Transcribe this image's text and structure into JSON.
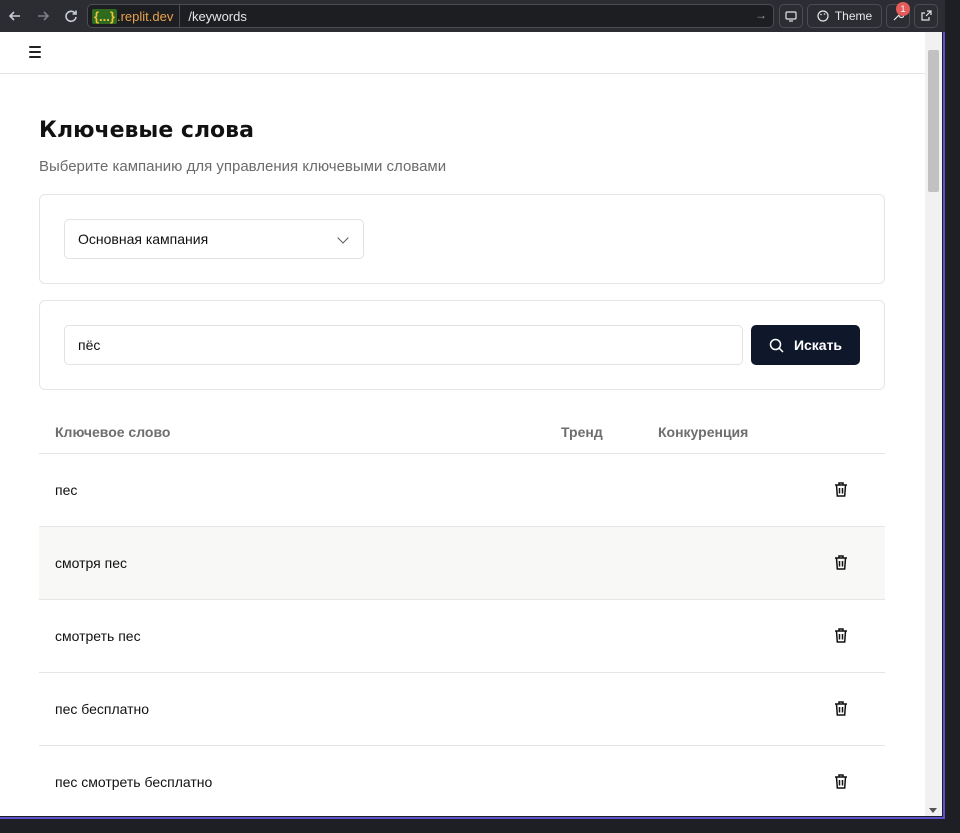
{
  "browser": {
    "url_host": ".replit.dev",
    "url_braces": "{...}",
    "url_path": "/keywords",
    "theme_label": "Theme",
    "notification_count": "1"
  },
  "page": {
    "title": "Ключевые слова",
    "subtitle": "Выберите кампанию для управления ключевыми словами"
  },
  "campaign_select": {
    "value": "Основная кампания"
  },
  "search": {
    "value": "пёс",
    "button_label": "Искать"
  },
  "table": {
    "columns": [
      "Ключевое слово",
      "Тренд",
      "Конкуренция"
    ],
    "rows": [
      {
        "keyword": "пес"
      },
      {
        "keyword": "смотря пес"
      },
      {
        "keyword": "смотреть пес"
      },
      {
        "keyword": "пес бесплатно"
      },
      {
        "keyword": "пес смотреть бесплатно"
      }
    ]
  },
  "icons": {
    "back": "arrow-left-icon",
    "forward": "arrow-right-icon",
    "reload": "reload-icon",
    "menu": "hamburger-icon",
    "chevron": "chevron-down-icon",
    "search": "search-icon",
    "delete": "trash-icon"
  },
  "colors": {
    "primary_button": "#0f172a",
    "frame_border": "#5c52c9",
    "badge": "#e55a5a"
  }
}
